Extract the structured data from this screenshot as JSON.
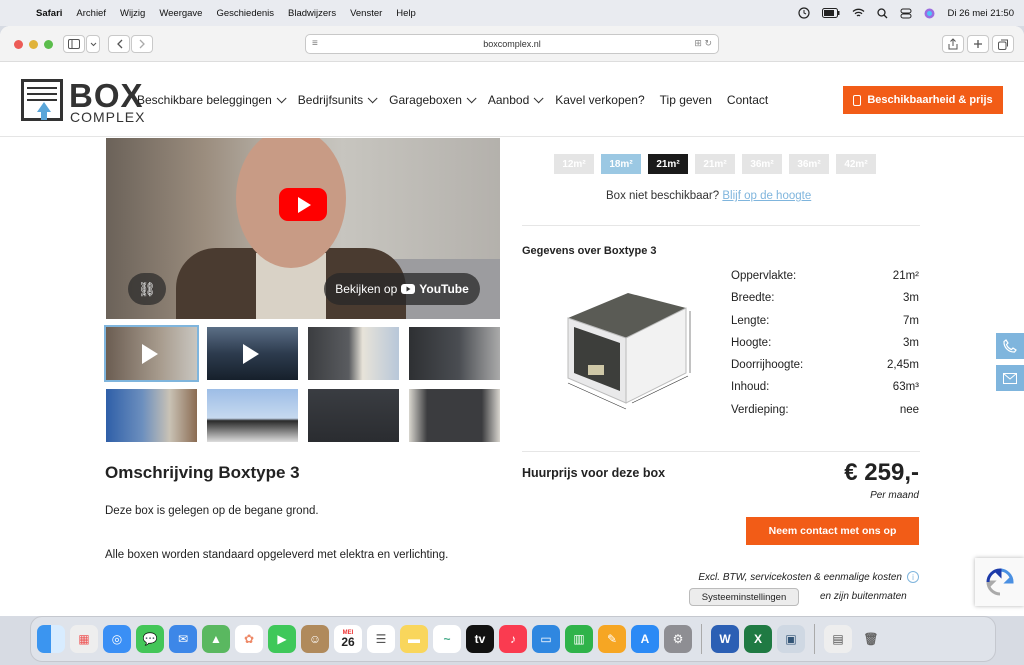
{
  "menubar": {
    "app": "Safari",
    "items": [
      "Archief",
      "Wijzig",
      "Weergave",
      "Geschiedenis",
      "Bladwijzers",
      "Venster",
      "Help"
    ],
    "clock": "Di 26 mei  21:50"
  },
  "browser": {
    "url": "boxcomplex.nl"
  },
  "logo": {
    "line1": "BOX",
    "line2": "COMPLEX"
  },
  "nav": {
    "items": [
      {
        "label": "Beschikbare beleggingen",
        "dropdown": true
      },
      {
        "label": "Bedrijfsunits",
        "dropdown": true
      },
      {
        "label": "Garageboxen",
        "dropdown": true
      },
      {
        "label": "Aanbod",
        "dropdown": true
      },
      {
        "label": "Kavel verkopen?",
        "dropdown": false
      },
      {
        "label": "Tip geven",
        "dropdown": false
      },
      {
        "label": "Contact",
        "dropdown": false
      }
    ],
    "cta": "Beschikbaarheid & prijs"
  },
  "video": {
    "watch_label": "Bekijken op",
    "youtube": "YouTube"
  },
  "sizes": [
    {
      "label": "12m²",
      "state": "unavailable"
    },
    {
      "label": "18m²",
      "state": "available"
    },
    {
      "label": "21m²",
      "state": "active"
    },
    {
      "label": "21m²",
      "state": "unavailable"
    },
    {
      "label": "36m²",
      "state": "unavailable"
    },
    {
      "label": "36m²",
      "state": "unavailable"
    },
    {
      "label": "42m²",
      "state": "unavailable"
    }
  ],
  "availability": {
    "text": "Box niet beschikbaar?",
    "link": "Blijf op de hoogte"
  },
  "specs": {
    "title": "Gegevens over Boxtype 3",
    "rows": [
      {
        "label": "Oppervlakte:",
        "value": "21m²"
      },
      {
        "label": "Breedte:",
        "value": "3m"
      },
      {
        "label": "Lengte:",
        "value": "7m"
      },
      {
        "label": "Hoogte:",
        "value": "3m"
      },
      {
        "label": "Doorrijhoogte:",
        "value": "2,45m"
      },
      {
        "label": "Inhoud:",
        "value": "63m³"
      },
      {
        "label": "Verdieping:",
        "value": "nee"
      }
    ]
  },
  "description": {
    "title": "Omschrijving Boxtype 3",
    "p1": "Deze box is gelegen op de begane grond.",
    "p2": "Alle boxen worden standaard opgeleverd met elektra en verlichting."
  },
  "price": {
    "label": "Huurprijs voor deze box",
    "amount": "€ 259,-",
    "period": "Per maand",
    "cta": "Neem contact met ons op",
    "note": "Excl. BTW, servicekosten & eenmalige kosten",
    "note2": "en zijn buitenmaten"
  },
  "tooltip": "Systeeminstellingen",
  "dock": {
    "calendar_month": "MEI",
    "calendar_day": "26"
  },
  "colors": {
    "accent": "#f25c17",
    "brand_blue": "#7fb5dd"
  }
}
